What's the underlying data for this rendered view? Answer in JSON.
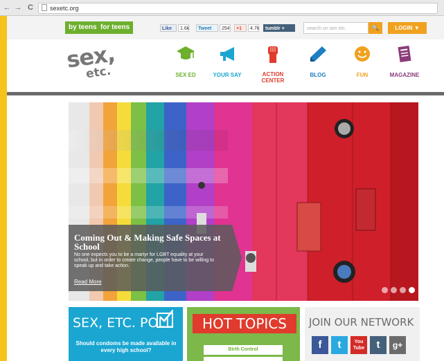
{
  "browser": {
    "url": "sexetc.org",
    "nav": {
      "back": "←",
      "forward": "→",
      "reload": "C"
    }
  },
  "topbar": {
    "pill_by_teens": "by teens",
    "pill_for_teens": "for teens",
    "facebook_like": "Like",
    "facebook_count": "1.6k",
    "tweet_label": "Tweet",
    "tweet_count": "254",
    "gplus_label": "+1",
    "gplus_count": "4.7k",
    "tumblr_label": "tumblr +",
    "search_placeholder": "search on sex etc.",
    "search_icon": "🔍",
    "login_label": "LOGIN ▼"
  },
  "header": {
    "logo_main": "sex,",
    "logo_sub": "etc.",
    "nav": [
      {
        "label": "SEX ED",
        "color": "#6caf2d",
        "icon": "graduation-cap-icon"
      },
      {
        "label": "YOUR SAY",
        "color": "#1ba6d2",
        "icon": "megaphone-icon"
      },
      {
        "label": "ACTION\nCENTER",
        "color": "#e03b2c",
        "icon": "raised-fist-icon"
      },
      {
        "label": "BLOG",
        "color": "#1e7fc3",
        "icon": "pencil-icon"
      },
      {
        "label": "FUN",
        "color": "#f0a11e",
        "icon": "smiley-icon"
      },
      {
        "label": "MAGAZINE",
        "color": "#8a3b7a",
        "icon": "magazine-icon"
      }
    ]
  },
  "hero": {
    "title": "Coming Out & Making Safe Spaces at School",
    "body": "No one expects you to be a martyr for LGBT equality at your school, but in order to create change, people have to be willing to speak up and take action.",
    "read_more": "Read More",
    "slide_count": 4,
    "active_slide": 4
  },
  "poll": {
    "title": "SEX, ETC. POLL",
    "question": "Should condoms be made available in every high school?"
  },
  "hot_topics": {
    "title": "HOT TOPICS",
    "items": [
      "Birth Control",
      ""
    ]
  },
  "network": {
    "title": "JOIN OUR NETWORK",
    "buttons": [
      {
        "label": "f",
        "color": "#3b5998",
        "icon": "facebook-icon"
      },
      {
        "label": "t",
        "color": "#2aa9e0",
        "icon": "twitter-icon"
      },
      {
        "label": "You Tube",
        "color": "#d32b27",
        "icon": "youtube-icon"
      },
      {
        "label": "t",
        "color": "#45607a",
        "icon": "tumblr-icon"
      },
      {
        "label": "g+",
        "color": "#6b6b6b",
        "icon": "google-plus-icon"
      }
    ]
  }
}
